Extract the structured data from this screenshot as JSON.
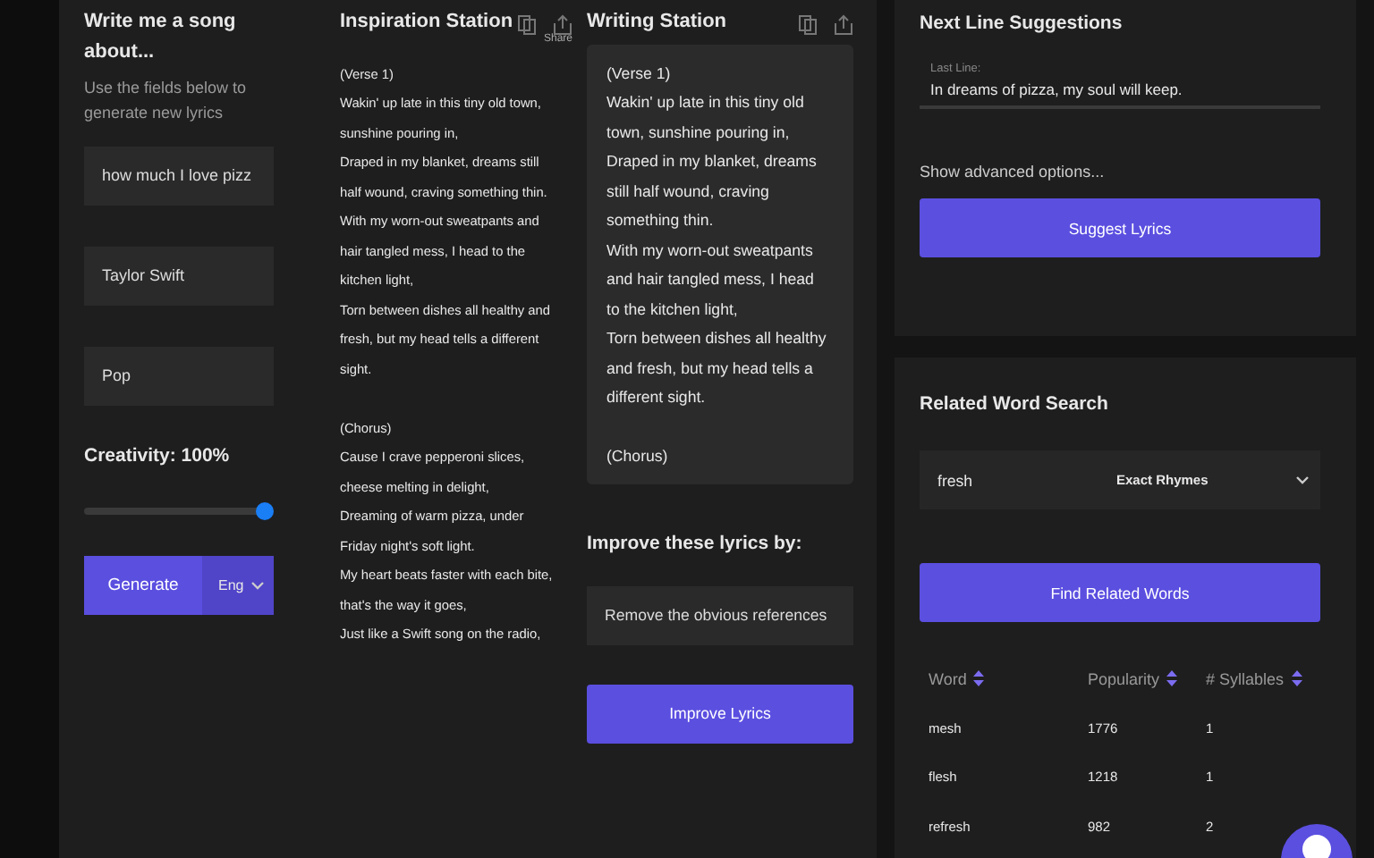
{
  "song_form": {
    "title": "Write me a song about...",
    "subtitle": "Use the fields below to generate new lyrics",
    "fields": [
      {
        "value": "how much I love pizz"
      },
      {
        "value": "Taylor Swift"
      },
      {
        "value": "Pop"
      }
    ],
    "creativity_label": "Creativity: 100%",
    "creativity": {
      "level": 1.0
    },
    "generate_button": "Generate",
    "language": "Eng"
  },
  "inspiration": {
    "title": "Inspiration Station",
    "share_label": "Share",
    "stanzas": [
      {
        "lines": [
          "(Verse 1)",
          "Wakin' up late in this tiny old town,",
          "sunshine pouring in,",
          "Draped in my blanket, dreams still",
          "half wound, craving something thin.",
          "With my worn-out sweatpants and",
          "hair tangled mess, I head to the",
          "kitchen light,",
          "Torn between dishes all healthy and",
          "fresh, but my head tells a different",
          "sight."
        ]
      },
      {
        "lines": [
          "(Chorus)",
          "Cause I crave pepperoni slices,",
          "cheese melting in delight,",
          "Dreaming of warm pizza, under",
          "Friday night's soft light.",
          "My heart beats faster with each bite,",
          "that's the way it goes,",
          "Just like a Swift song on the radio,"
        ]
      }
    ]
  },
  "writing": {
    "title": "Writing Station",
    "stanzas": [
      {
        "lines": [
          "(Verse 1)",
          "Wakin' up late in this tiny old",
          "town, sunshine pouring in,",
          "Draped in my blanket, dreams",
          "still half wound, craving",
          "something thin.",
          "With my worn-out sweatpants",
          "and hair tangled mess, I head",
          "to the kitchen light,",
          "Torn between dishes all healthy",
          "and fresh, but my head tells a",
          "different sight."
        ]
      },
      {
        "lines": [
          "(Chorus)"
        ]
      }
    ],
    "improve_label": "Improve these lyrics by:",
    "improve_value": "Remove the obvious references",
    "improve_button": "Improve Lyrics"
  },
  "next_line": {
    "title": "Next Line Suggestions",
    "field_label": "Last Line:",
    "field_value": "In dreams of pizza, my soul will keep.",
    "advanced": "Show advanced options...",
    "button": "Suggest Lyrics"
  },
  "related": {
    "title": "Related Word Search",
    "query": "fresh",
    "mode": "Exact Rhymes",
    "button": "Find Related Words",
    "columns": [
      "Word",
      "Popularity",
      "# Syllables"
    ],
    "rows": [
      [
        "mesh",
        "1776",
        "1"
      ],
      [
        "flesh",
        "1218",
        "1"
      ],
      [
        "refresh",
        "982",
        "2"
      ]
    ]
  }
}
